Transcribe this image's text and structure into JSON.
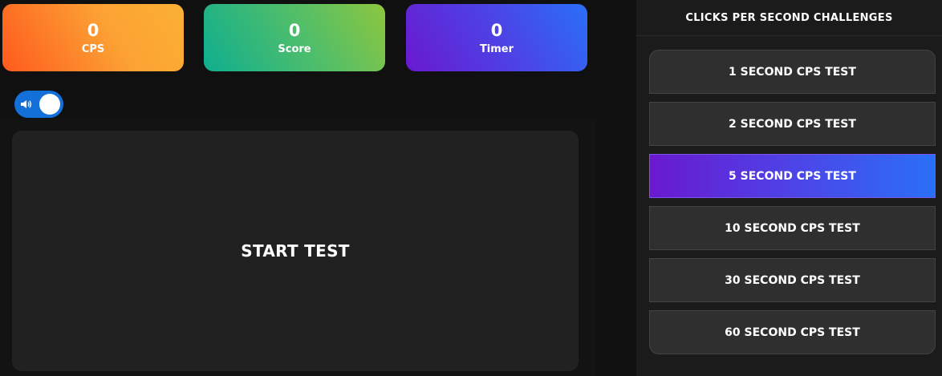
{
  "stats": {
    "cps": {
      "value": "0",
      "label": "CPS"
    },
    "score": {
      "value": "0",
      "label": "Score"
    },
    "timer": {
      "value": "0",
      "label": "Timer"
    }
  },
  "sound_toggle": {
    "on": true,
    "icon": "speaker-icon"
  },
  "start_area": {
    "label": "START TEST"
  },
  "panel": {
    "title": "CLICKS PER SECOND CHALLENGES",
    "tests": [
      {
        "label": "1 SECOND CPS TEST"
      },
      {
        "label": "2 SECOND CPS TEST"
      },
      {
        "label": "5 SECOND CPS TEST",
        "active": true
      },
      {
        "label": "10 SECOND CPS TEST"
      },
      {
        "label": "30 SECOND CPS TEST"
      },
      {
        "label": "60 SECOND CPS TEST"
      }
    ]
  },
  "colors": {
    "background": "#111011",
    "card": "#222122",
    "panel": "#1c1b1c",
    "toggle": "#1470d9",
    "active_gradient_start": "#6a19d0",
    "active_gradient_end": "#2a6ff7"
  }
}
